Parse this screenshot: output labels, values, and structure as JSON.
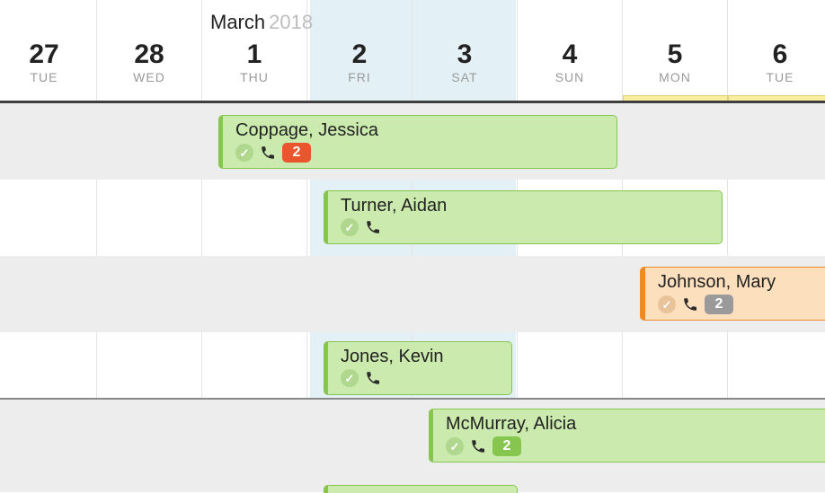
{
  "header": {
    "month": "March",
    "year": "2018"
  },
  "days": [
    {
      "num": "27",
      "dow": "TUE"
    },
    {
      "num": "28",
      "dow": "WED"
    },
    {
      "num": "1",
      "dow": "THU"
    },
    {
      "num": "2",
      "dow": "FRI",
      "selected": true
    },
    {
      "num": "3",
      "dow": "SAT"
    },
    {
      "num": "4",
      "dow": "SUN"
    },
    {
      "num": "5",
      "dow": "MON",
      "highlight": true
    },
    {
      "num": "6",
      "dow": "TUE",
      "highlight": true
    }
  ],
  "events": [
    {
      "name": "Coppage, Jessica",
      "style": "green",
      "badge": "2",
      "badgeColor": "red"
    },
    {
      "name": "Turner, Aidan",
      "style": "green"
    },
    {
      "name": "Johnson, Mary",
      "style": "orange",
      "badge": "2",
      "badgeColor": "gray"
    },
    {
      "name": "Jones, Kevin",
      "style": "green"
    },
    {
      "name": "McMurray, Alicia",
      "style": "green",
      "badge": "2",
      "badgeColor": "green"
    }
  ]
}
